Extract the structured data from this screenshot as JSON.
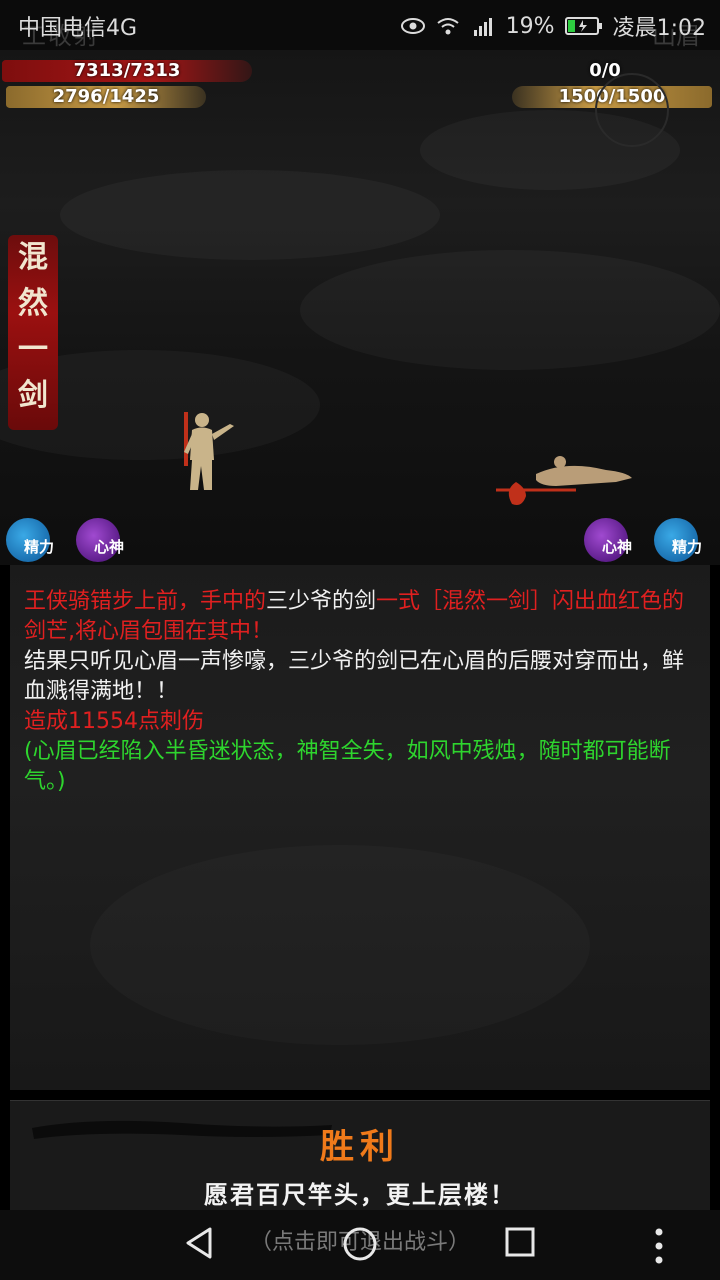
{
  "status": {
    "carrier": "中国电信4G",
    "battery": "19%",
    "time": "凌晨1:02",
    "ghost_left": "工收射",
    "ghost_right": "山眉"
  },
  "player": {
    "hp": "7313/7313",
    "mp": "2796/1425"
  },
  "enemy": {
    "hp": "0/0",
    "mp": "1500/1500"
  },
  "skill": {
    "chars": [
      "混",
      "然",
      "一",
      "剑"
    ]
  },
  "stats": {
    "left_energy": "精力",
    "left_spirit": "心神",
    "right_spirit": "心神",
    "right_energy": "精力"
  },
  "log": {
    "seg1_red": "王侠骑错步上前，手中的",
    "seg1_white": "三少爷的剑",
    "seg1_red2": "一式［混然一剑］闪出血红色的剑芒,将心眉包围在其中！",
    "seg2_white": "结果只听见心眉一声惨嚎，三少爷的剑已在心眉的后腰对穿而出，鲜血溅得满地！！",
    "seg3_red": "造成11554点刺伤",
    "seg4_green": "(心眉已经陷入半昏迷状态，神智全失，如风中残烛，随时都可能断气。)"
  },
  "result": {
    "title": "胜利",
    "motto": "愿君百尺竿头，更上层楼！"
  },
  "nav": {
    "exit_hint": "（点击即可退出战斗）"
  },
  "colors": {
    "hp_red": "#a51616",
    "mp_gold": "#c79a45",
    "victory_orange": "#f07a1a",
    "log_green": "#2ed52e",
    "log_red": "#e02020"
  }
}
